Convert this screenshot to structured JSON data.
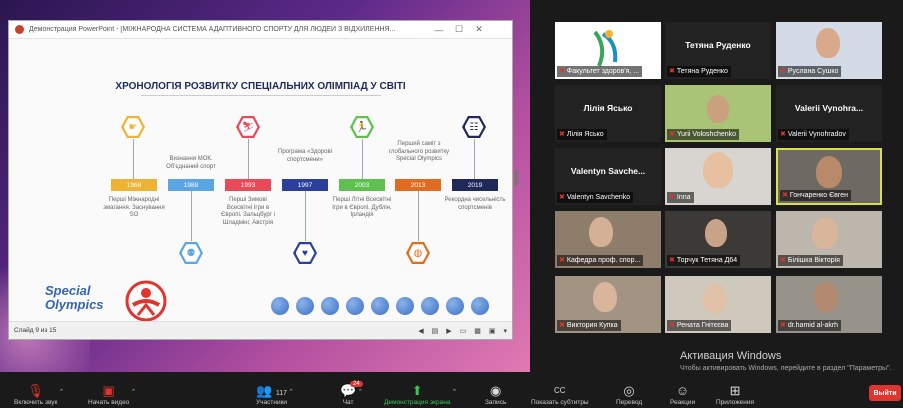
{
  "ppt": {
    "window_title": "Демонстрация PowerPoint - [МІЖНАРОДНА СИСТЕМА АДАПТИВНОГО СПОРТУ ДЛЯ ЛЮДЕЙ З ВІДХИЛЕННЯ...",
    "minimize": "—",
    "maximize": "☐",
    "close": "✕",
    "slide_title": "ХРОНОЛОГІЯ РОЗВИТКУ СПЕЦІАЛЬНИХ ОЛІМПІАД У СВІТІ",
    "status": "Слайд 9 из 15",
    "logo_line1": "Special",
    "logo_line2": "Olympics",
    "timeline": [
      {
        "year": "1968",
        "color": "#f0b233",
        "caption": "Перші Міжнародні змагання. Заснування SO",
        "pos": "below"
      },
      {
        "year": "1988",
        "color": "#5aa5e3",
        "caption": "Визнання МОК. Об'єднаний спорт",
        "pos": "above"
      },
      {
        "year": "1993",
        "color": "#e84a57",
        "caption": "Перші Зимові Всесвітні Ігри в Європі. Зальцбург і Шладмінг, Австрія",
        "pos": "below"
      },
      {
        "year": "1997",
        "color": "#2b3f9d",
        "caption": "Програма «Здорові спортсмени»",
        "pos": "above"
      },
      {
        "year": "2003",
        "color": "#5ec04f",
        "caption": "Перші Літні Всесвітні Ігри в Європі. Дублін, Ірландія",
        "pos": "below"
      },
      {
        "year": "2013",
        "color": "#e06d1f",
        "caption": "Перший саміт з глобального розвитку Special Olympics",
        "pos": "above"
      },
      {
        "year": "2019",
        "color": "#1f2a5a",
        "caption": "Рекордна чисельність спортсменів",
        "pos": "below"
      }
    ]
  },
  "participants": [
    {
      "label": "Факультет здоров'я, ...",
      "big_name": "",
      "type": "logo"
    },
    {
      "label": "Тетяна Руденко",
      "big_name": "Тетяна Руденко",
      "type": "name"
    },
    {
      "label": "Руслана Сушко",
      "big_name": "",
      "type": "video"
    },
    {
      "label": "Лілія Ясько",
      "big_name": "Лілія Ясько",
      "type": "name"
    },
    {
      "label": "Yurii Voloshchenko",
      "big_name": "",
      "type": "video"
    },
    {
      "label": "Valerii Vynohradov",
      "big_name": "Valerii Vynohra...",
      "type": "name"
    },
    {
      "label": "Valentyn Savchenko",
      "big_name": "Valentyn Savche...",
      "type": "name"
    },
    {
      "label": "Inna",
      "big_name": "",
      "type": "video"
    },
    {
      "label": "Гончаренко Євген",
      "big_name": "",
      "type": "video"
    },
    {
      "label": "Кафедра проф. спор...",
      "big_name": "",
      "type": "video"
    },
    {
      "label": "Торчук Тетяна Д64",
      "big_name": "",
      "type": "video"
    },
    {
      "label": "Білішка Вікторія",
      "big_name": "",
      "type": "video"
    },
    {
      "label": "Виктория Купка",
      "big_name": "",
      "type": "video"
    },
    {
      "label": "Рената Гнітєєва",
      "big_name": "",
      "type": "video"
    },
    {
      "label": "dr.hamid al-akrh",
      "big_name": "",
      "type": "video"
    }
  ],
  "watermark": {
    "line1": "Активация Windows",
    "line2": "Чтобы активировать Windows, перейдите в раздел \"Параметры\"."
  },
  "toolbar": {
    "unmute": "Включить звук",
    "start_video": "Начать видео",
    "participants": "Участники",
    "participants_count": "117",
    "chat": "Чат",
    "chat_badge": "24",
    "share": "Демонстрация экрана",
    "record": "Запись",
    "subtitles": "Показать субтитры",
    "translate": "Перевод",
    "reactions": "Реакции",
    "apps": "Приложения",
    "leave": "Выйти",
    "cc": "CC"
  },
  "colors": {
    "zoom_red": "#e0342f",
    "share_green": "#3cc457",
    "active_border": "#d8e14a"
  }
}
